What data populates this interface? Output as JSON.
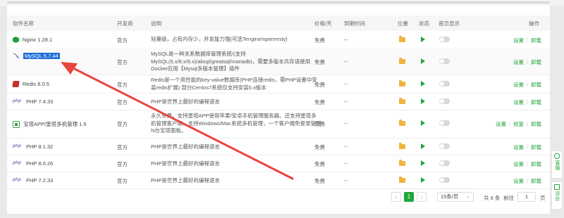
{
  "columns": {
    "name": "软件名称",
    "developer": "开发商",
    "desc": "说明",
    "price": "价格/天",
    "expire": "到期时间",
    "location": "位置",
    "status": "状态",
    "home": "首页显示",
    "ops": "操作"
  },
  "rows": [
    {
      "name": "Nginx 1.28.1",
      "icon": "nginx-icon",
      "developer": "官方",
      "desc": "轻量级，占有内存少，并发能力强(可选Tengine/openresty)",
      "price": "免费",
      "expire": "--",
      "ops": [
        "设置",
        "卸载"
      ]
    },
    {
      "name": "MySQL 5.7.44",
      "icon": "mysql-icon",
      "developer": "官方",
      "desc": "MySQL是一种关系数据库管理系统!(支持MySQL(5.x/8.x/9.x)/alisql/greatsql/mariadb)，需要多版本共存请使用Docker应用【Mysql多版本管理】插件",
      "price": "免费",
      "expire": "--",
      "ops": [
        "设置",
        "卸载"
      ]
    },
    {
      "name": "Redis 8.0.5",
      "icon": "redis-icon",
      "developer": "官方",
      "desc": "Redis是一个高性能的key-value数据库(PHP连接redis，需PHP设置中安装redis扩展) 部分Centos7系统仅支持安装5.x版本",
      "price": "免费",
      "expire": "--",
      "ops": [
        "设置",
        "卸载"
      ]
    },
    {
      "name": "PHP 7.4.33",
      "icon": "php-icon",
      "developer": "官方",
      "desc": "PHP是世界上最好的编程语言",
      "price": "免费",
      "expire": "--",
      "ops": [
        "设置",
        "卸载"
      ]
    },
    {
      "name": "宝塔APP/堡塔多机管理 1.5",
      "icon": "bt-app-icon",
      "developer": "官方",
      "desc": "永久免费，支持堡塔APP使用苹果/安卓手机管理服务器。还支持堡塔多机管理客户端，支持Windows/Mac系统多机管理，一个客户端免登录管理N台宝塔面板。",
      "price": "免费",
      "expire": "--",
      "ops": [
        "设置",
        "修复",
        "卸载"
      ]
    },
    {
      "name": "PHP 8.1.32",
      "icon": "php-icon",
      "developer": "官方",
      "desc": "PHP是世界上最好的编程语言",
      "price": "免费",
      "expire": "--",
      "ops": [
        "设置",
        "卸载"
      ]
    },
    {
      "name": "PHP 8.0.26",
      "icon": "php-icon",
      "developer": "官方",
      "desc": "PHP是世界上最好的编程语言",
      "price": "免费",
      "expire": "--",
      "ops": [
        "设置",
        "卸载"
      ]
    },
    {
      "name": "PHP 7.2.33",
      "icon": "php-icon",
      "developer": "官方",
      "desc": "PHP是世界上最好的编程语言",
      "price": "免费",
      "expire": "--",
      "ops": [
        "设置",
        "卸载"
      ]
    }
  ],
  "php_badge": "php",
  "pagination": {
    "prev": "‹",
    "current": "1",
    "next": "›",
    "page_size": "15条/页",
    "total": "共 8 条",
    "goto_label": "前往",
    "goto_value": "1",
    "page_unit": "页"
  },
  "side": {
    "service": "客服",
    "review": "评价"
  },
  "colors": {
    "accent": "#20a53a",
    "selection": "#1e6fd9",
    "annotation_arrow": "#e8453c",
    "folder": "#f0b43c"
  }
}
